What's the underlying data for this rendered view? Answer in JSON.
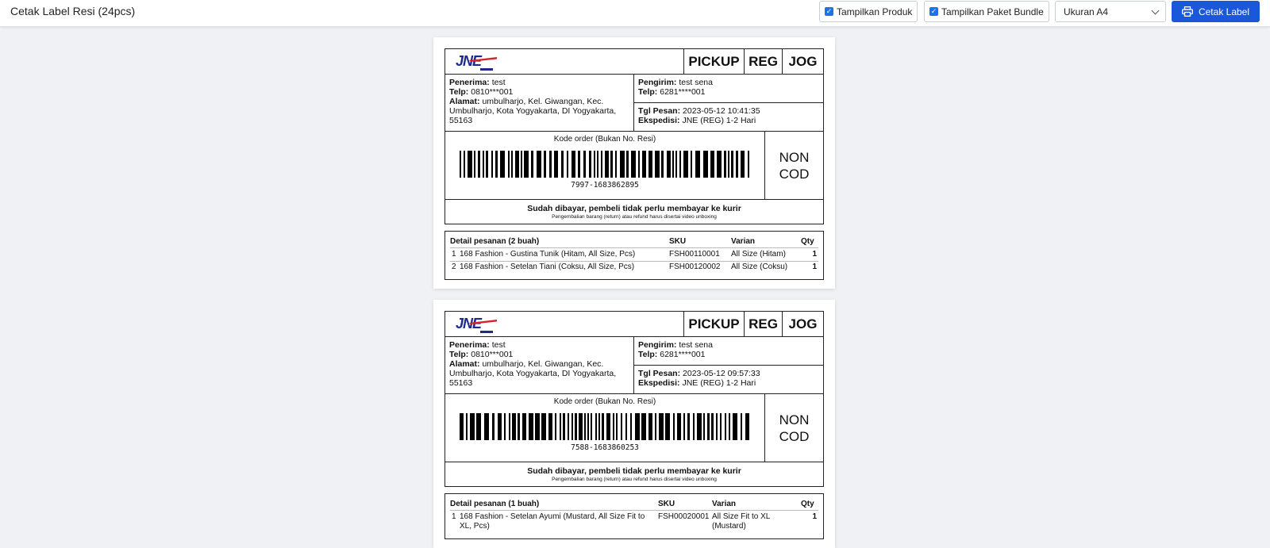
{
  "toolbar": {
    "title": "Cetak Label Resi (24pcs)",
    "show_products_label": "Tampilkan Produk",
    "show_bundle_label": "Tampilkan Paket Bundle",
    "size_select_value": "Ukuran A4",
    "print_button_label": "Cetak Label",
    "accent_color": "#1a57db"
  },
  "labels": [
    {
      "courier_logo": "JNE",
      "tags": [
        "PICKUP",
        "REG",
        "JOG"
      ],
      "recipient_label": "Penerima:",
      "recipient_name": "test",
      "recipient_phone_label": "Telp:",
      "recipient_phone": "0810***001",
      "recipient_address_label": "Alamat:",
      "recipient_address": "umbulharjo, Kel. Giwangan, Kec. Umbulharjo, Kota Yogyakarta, DI Yogyakarta, 55163",
      "sender_label": "Pengirim:",
      "sender_name": "test sena",
      "sender_phone_label": "Telp:",
      "sender_phone": "6281****001",
      "order_date_label": "Tgl Pesan:",
      "order_date": "2023-05-12 10:41:35",
      "expedition_label": "Ekspedisi:",
      "expedition": "JNE (REG) 1-2 Hari",
      "order_code_title": "Kode order (Bukan No. Resi)",
      "order_code": "7997-1683862895",
      "cod_status": "NON COD",
      "paid_note": "Sudah dibayar, pembeli tidak perlu membayar ke kurir",
      "return_note": "Pengembalian barang (return) atau refund harus disertai video unboxing",
      "detail_header": "Detail pesanan (2 buah)",
      "col_sku": "SKU",
      "col_variant": "Varian",
      "col_qty": "Qty",
      "items": [
        {
          "no": "1",
          "name": "168 Fashion - Gustina Tunik (Hitam, All Size, Pcs)",
          "sku": "FSH00110001",
          "variant": "All Size (Hitam)",
          "qty": "1"
        },
        {
          "no": "2",
          "name": "168 Fashion - Setelan Tiani (Coksu, All Size, Pcs)",
          "sku": "FSH00120002",
          "variant": "All Size (Coksu)",
          "qty": "1"
        }
      ]
    },
    {
      "courier_logo": "JNE",
      "tags": [
        "PICKUP",
        "REG",
        "JOG"
      ],
      "recipient_label": "Penerima:",
      "recipient_name": "test",
      "recipient_phone_label": "Telp:",
      "recipient_phone": "0810***001",
      "recipient_address_label": "Alamat:",
      "recipient_address": "umbulharjo, Kel. Giwangan, Kec. Umbulharjo, Kota Yogyakarta, DI Yogyakarta, 55163",
      "sender_label": "Pengirim:",
      "sender_name": "test sena",
      "sender_phone_label": "Telp:",
      "sender_phone": "6281****001",
      "order_date_label": "Tgl Pesan:",
      "order_date": "2023-05-12 09:57:33",
      "expedition_label": "Ekspedisi:",
      "expedition": "JNE (REG) 1-2 Hari",
      "order_code_title": "Kode order (Bukan No. Resi)",
      "order_code": "7588-1683860253",
      "cod_status": "NON COD",
      "paid_note": "Sudah dibayar, pembeli tidak perlu membayar ke kurir",
      "return_note": "Pengembalian barang (return) atau refund harus disertai video unboxing",
      "detail_header": "Detail pesanan (1 buah)",
      "col_sku": "SKU",
      "col_variant": "Varian",
      "col_qty": "Qty",
      "items": [
        {
          "no": "1",
          "name": "168 Fashion - Setelan Ayumi (Mustard, All Size Fit to XL, Pcs)",
          "sku": "FSH00020001",
          "variant": "All Size Fit to XL (Mustard)",
          "qty": "1"
        }
      ]
    }
  ]
}
